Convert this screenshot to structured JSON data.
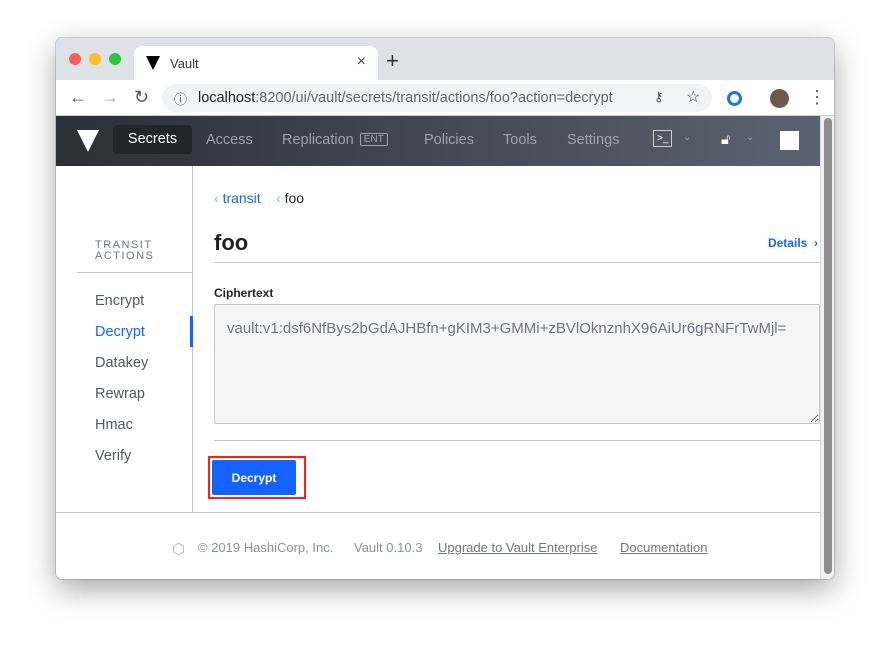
{
  "browser": {
    "tab_title": "Vault",
    "url_host": "localhost",
    "url_rest": ":8200/ui/vault/secrets/transit/actions/foo?action=decrypt"
  },
  "nav": {
    "items": [
      "Secrets",
      "Access",
      "Replication",
      "Policies",
      "Tools",
      "Settings"
    ],
    "ent_badge": "ENT"
  },
  "sidebar": {
    "heading_1": "TRANSIT",
    "heading_2": "ACTIONS",
    "items": [
      "Encrypt",
      "Decrypt",
      "Datakey",
      "Rewrap",
      "Hmac",
      "Verify"
    ],
    "active": "Decrypt"
  },
  "breadcrumb": {
    "parent": "transit",
    "current": "foo"
  },
  "page": {
    "title": "foo",
    "details_link": "Details"
  },
  "form": {
    "label": "Ciphertext",
    "value": "vault:v1:dsf6NfBys2bGdAJHBfn+gKIM3+GMMi+zBVlOknznhX96AiUr6gRNFrTwMjl=",
    "submit": "Decrypt"
  },
  "footer": {
    "copyright": "© 2019 HashiCorp, Inc.",
    "version": "Vault 0.10.3",
    "upgrade": "Upgrade to Vault Enterprise",
    "docs": "Documentation"
  },
  "colors": {
    "accent": "#1563ff",
    "highlight": "#ff1f0f"
  }
}
